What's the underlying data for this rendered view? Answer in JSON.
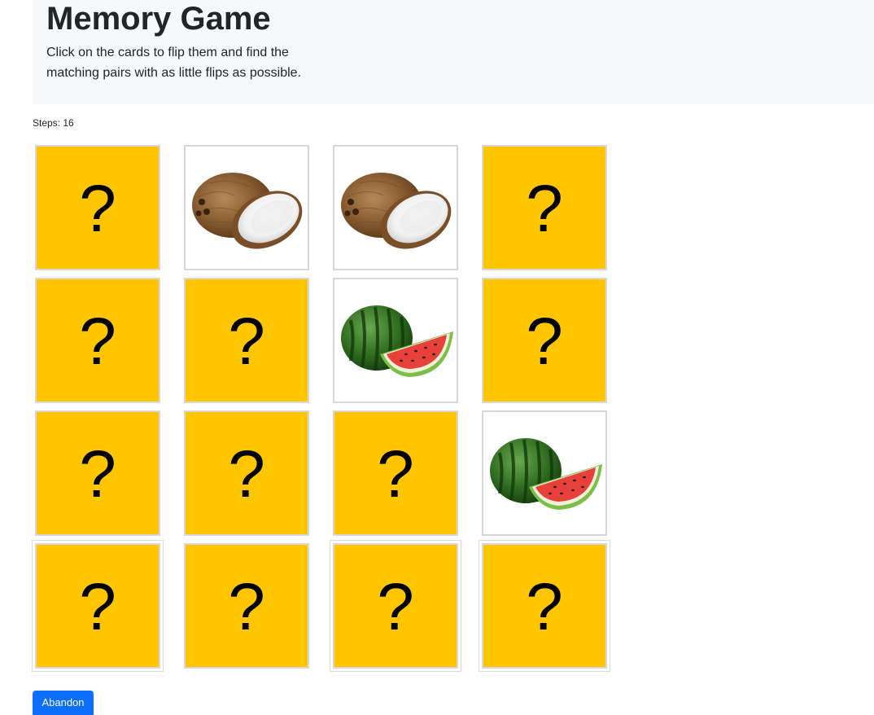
{
  "header": {
    "title": "Memory Game",
    "subtitle": "Click on the cards to flip them and find the matching pairs with as little flips as possible."
  },
  "status": {
    "steps_text": "Steps: 16"
  },
  "board": {
    "hidden_symbol": "?",
    "cards": [
      {
        "state": "hidden"
      },
      {
        "state": "revealed",
        "fruit": "coconut"
      },
      {
        "state": "revealed",
        "fruit": "coconut"
      },
      {
        "state": "hidden"
      },
      {
        "state": "hidden"
      },
      {
        "state": "hidden"
      },
      {
        "state": "revealed",
        "fruit": "watermelon"
      },
      {
        "state": "hidden"
      },
      {
        "state": "hidden"
      },
      {
        "state": "hidden"
      },
      {
        "state": "hidden"
      },
      {
        "state": "revealed",
        "fruit": "watermelon"
      },
      {
        "state": "hidden"
      },
      {
        "state": "hidden"
      },
      {
        "state": "hidden"
      },
      {
        "state": "hidden"
      }
    ]
  },
  "actions": {
    "abandon_label": "Abandon"
  },
  "colors": {
    "card_back": "#ffc600",
    "button": "#0d6efd"
  }
}
